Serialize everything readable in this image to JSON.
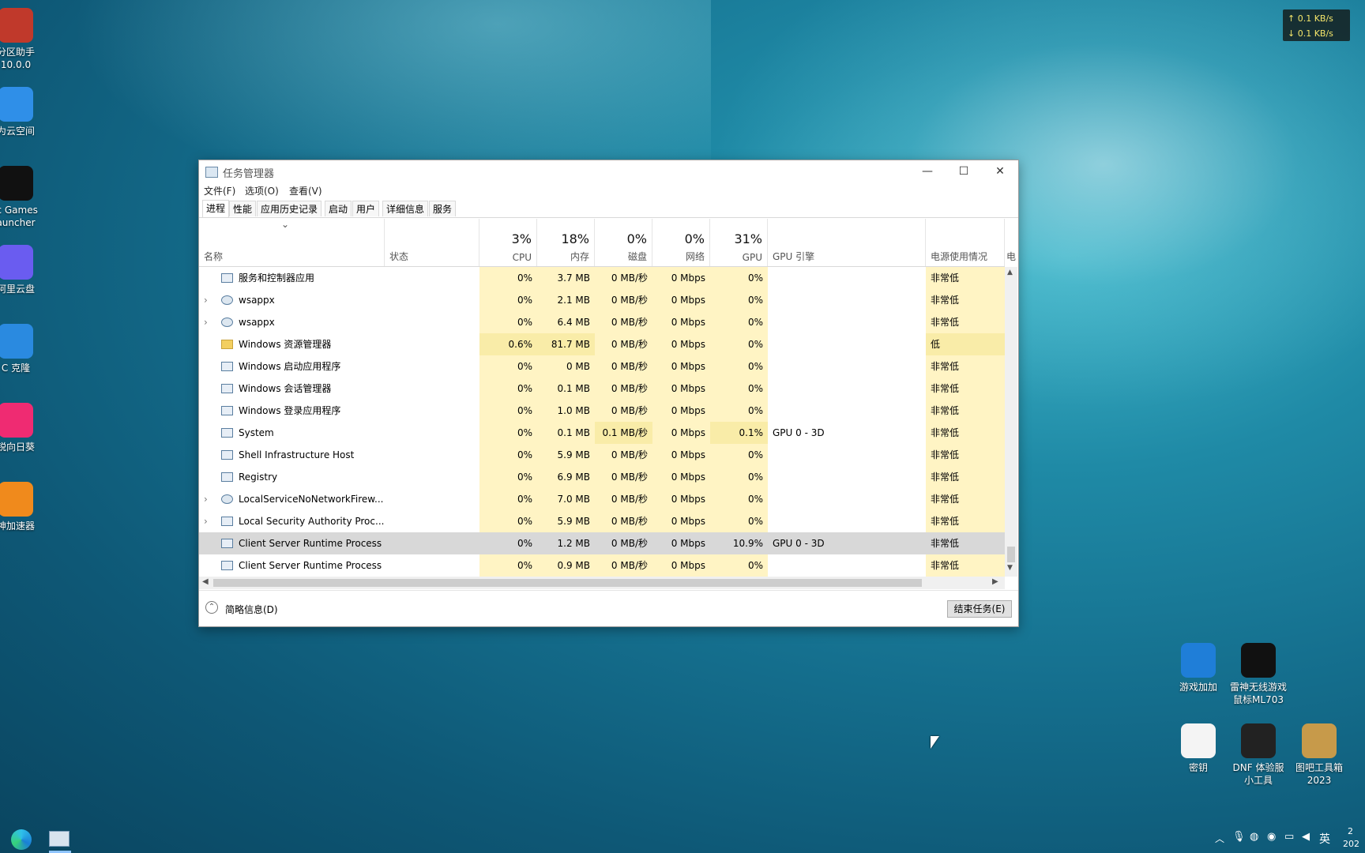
{
  "desktop": {
    "left_icons": [
      {
        "label": "分区助手\n10.0.0",
        "icon": "partition-assistant-icon",
        "color": "#c0392b"
      },
      {
        "label": "为云空间",
        "icon": "cloud-space-icon",
        "color": "#2f8fe8"
      },
      {
        "label": "ic Games\nauncher",
        "icon": "epic-games-icon",
        "color": "#111111"
      },
      {
        "label": "阿里云盘",
        "icon": "aliyun-drive-icon",
        "color": "#6a5cf0"
      },
      {
        "label": "C 克隆",
        "icon": "pc-clone-icon",
        "color": "#2a8ae0"
      },
      {
        "label": "锐向日葵",
        "icon": "sunflower-icon",
        "color": "#ef2b72"
      },
      {
        "label": "神加速器",
        "icon": "accelerator-icon",
        "color": "#f08a1c"
      }
    ],
    "right_icons": [
      {
        "label": "游戏加加",
        "icon": "game-plus-icon"
      },
      {
        "label": "雷神无线游戏\n鼠标ML703",
        "icon": "thunder-mouse-icon"
      },
      {
        "label": "密钥",
        "icon": "text-file-icon"
      },
      {
        "label": "DNF 体验服\n小工具",
        "icon": "dnf-tool-icon"
      },
      {
        "label": "图吧工具箱\n2023",
        "icon": "toolbox-icon"
      }
    ],
    "netspeed": {
      "up": "↑ 0.1 KB/s",
      "down": "↓ 0.1 KB/s"
    }
  },
  "window": {
    "title": "任务管理器",
    "menu": [
      "文件(F)",
      "选项(O)",
      "查看(V)"
    ],
    "tabs": [
      "进程",
      "性能",
      "应用历史记录",
      "启动",
      "用户",
      "详细信息",
      "服务"
    ],
    "active_tab": "进程",
    "sort_indicator": "⌄",
    "columns": {
      "name": "名称",
      "status": "状态",
      "cpu": {
        "pct": "3%",
        "label": "CPU"
      },
      "mem": {
        "pct": "18%",
        "label": "内存"
      },
      "disk": {
        "pct": "0%",
        "label": "磁盘"
      },
      "net": {
        "pct": "0%",
        "label": "网络"
      },
      "gpu": {
        "pct": "31%",
        "label": "GPU"
      },
      "gpu_engine": "GPU 引擎",
      "power": "电源使用情况",
      "power_trend": "电"
    },
    "rows": [
      {
        "expand": "",
        "icon": "window",
        "name": "服务和控制器应用",
        "cpu": "0%",
        "mem": "3.7 MB",
        "disk": "0 MB/秒",
        "net": "0 Mbps",
        "gpu": "0%",
        "engine": "",
        "power": "非常低"
      },
      {
        "expand": "›",
        "icon": "gear",
        "name": "wsappx",
        "cpu": "0%",
        "mem": "2.1 MB",
        "disk": "0 MB/秒",
        "net": "0 Mbps",
        "gpu": "0%",
        "engine": "",
        "power": "非常低"
      },
      {
        "expand": "›",
        "icon": "gear",
        "name": "wsappx",
        "cpu": "0%",
        "mem": "6.4 MB",
        "disk": "0 MB/秒",
        "net": "0 Mbps",
        "gpu": "0%",
        "engine": "",
        "power": "非常低"
      },
      {
        "expand": "",
        "icon": "folder",
        "name": "Windows 资源管理器",
        "cpu": "0.6%",
        "mem": "81.7 MB",
        "disk": "0 MB/秒",
        "net": "0 Mbps",
        "gpu": "0%",
        "engine": "",
        "power": "低"
      },
      {
        "expand": "",
        "icon": "window",
        "name": "Windows 启动应用程序",
        "cpu": "0%",
        "mem": "0 MB",
        "disk": "0 MB/秒",
        "net": "0 Mbps",
        "gpu": "0%",
        "engine": "",
        "power": "非常低"
      },
      {
        "expand": "",
        "icon": "window",
        "name": "Windows 会话管理器",
        "cpu": "0%",
        "mem": "0.1 MB",
        "disk": "0 MB/秒",
        "net": "0 Mbps",
        "gpu": "0%",
        "engine": "",
        "power": "非常低"
      },
      {
        "expand": "",
        "icon": "window",
        "name": "Windows 登录应用程序",
        "cpu": "0%",
        "mem": "1.0 MB",
        "disk": "0 MB/秒",
        "net": "0 Mbps",
        "gpu": "0%",
        "engine": "",
        "power": "非常低"
      },
      {
        "expand": "",
        "icon": "window",
        "name": "System",
        "cpu": "0%",
        "mem": "0.1 MB",
        "disk": "0.1 MB/秒",
        "net": "0 Mbps",
        "gpu": "0.1%",
        "engine": "GPU 0 - 3D",
        "power": "非常低"
      },
      {
        "expand": "",
        "icon": "window",
        "name": "Shell Infrastructure Host",
        "cpu": "0%",
        "mem": "5.9 MB",
        "disk": "0 MB/秒",
        "net": "0 Mbps",
        "gpu": "0%",
        "engine": "",
        "power": "非常低"
      },
      {
        "expand": "",
        "icon": "window",
        "name": "Registry",
        "cpu": "0%",
        "mem": "6.9 MB",
        "disk": "0 MB/秒",
        "net": "0 Mbps",
        "gpu": "0%",
        "engine": "",
        "power": "非常低"
      },
      {
        "expand": "›",
        "icon": "gear",
        "name": "LocalServiceNoNetworkFirew...",
        "cpu": "0%",
        "mem": "7.0 MB",
        "disk": "0 MB/秒",
        "net": "0 Mbps",
        "gpu": "0%",
        "engine": "",
        "power": "非常低"
      },
      {
        "expand": "›",
        "icon": "window",
        "name": "Local Security Authority Proc...",
        "cpu": "0%",
        "mem": "5.9 MB",
        "disk": "0 MB/秒",
        "net": "0 Mbps",
        "gpu": "0%",
        "engine": "",
        "power": "非常低"
      },
      {
        "expand": "",
        "icon": "window",
        "name": "Client Server Runtime Process",
        "cpu": "0%",
        "mem": "1.2 MB",
        "disk": "0 MB/秒",
        "net": "0 Mbps",
        "gpu": "10.9%",
        "engine": "GPU 0 - 3D",
        "power": "非常低",
        "selected": true
      },
      {
        "expand": "",
        "icon": "window",
        "name": "Client Server Runtime Process",
        "cpu": "0%",
        "mem": "0.9 MB",
        "disk": "0 MB/秒",
        "net": "0 Mbps",
        "gpu": "0%",
        "engine": "",
        "power": "非常低"
      }
    ],
    "fewer_details": "简略信息(D)",
    "end_task": "结束任务(E)"
  },
  "taskbar": {
    "tray_lang": "英",
    "clock_partial": "2",
    "date_partial": "202"
  }
}
